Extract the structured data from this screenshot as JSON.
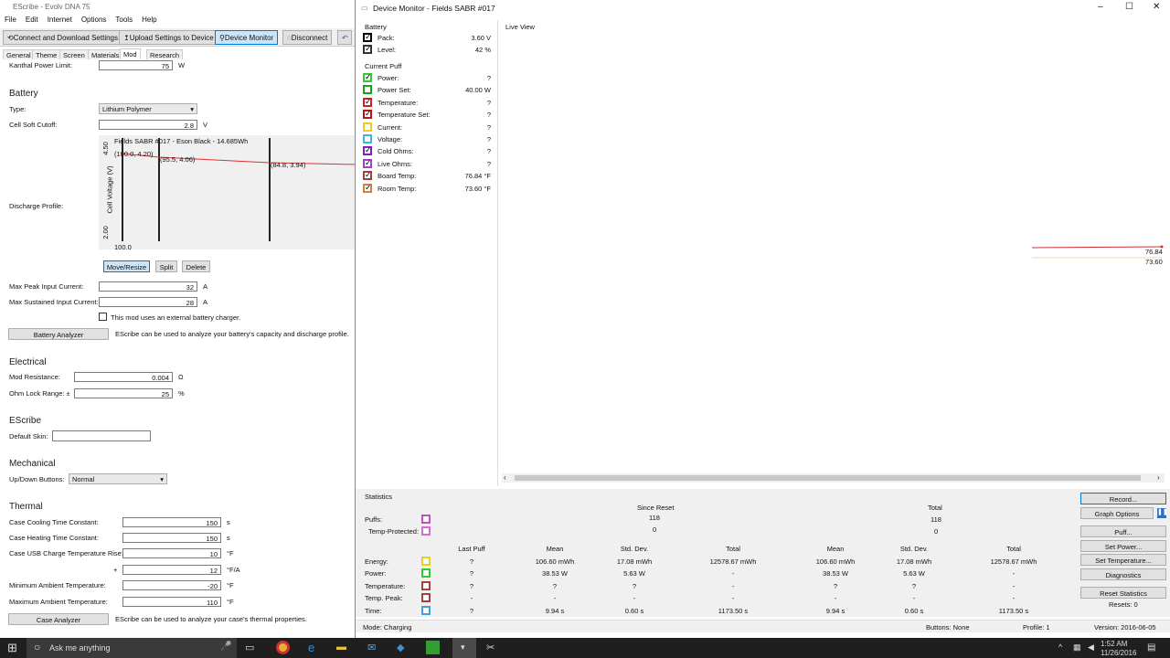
{
  "left_window": {
    "title": "EScribe - Evolv DNA 75",
    "menu": [
      "File",
      "Edit",
      "Internet",
      "Options",
      "Tools",
      "Help"
    ],
    "toolbar": {
      "connect": "Connect and Download Settings",
      "upload": "Upload Settings to Device",
      "monitor": "Device Monitor",
      "disconnect": "Disconnect"
    },
    "tabs": [
      "General",
      "Theme",
      "Screen",
      "Materials",
      "Mod",
      "Research"
    ],
    "kanthal_label": "Kanthal Power Limit:",
    "kanthal_value": "75",
    "kanthal_unit": "W",
    "battery": {
      "heading": "Battery",
      "type_label": "Type:",
      "type_value": "Lithium Polymer",
      "cutoff_label": "Cell Soft Cutoff:",
      "cutoff_value": "2.8",
      "cutoff_unit": "V",
      "discharge_label": "Discharge Profile:",
      "chart_title": "Fields SABR #017 - Eson Black - 14.685Wh",
      "ylabel": "Cell Voltage (V)",
      "ytop": "4.50",
      "ybot": "2.00",
      "xleft": "100.0",
      "pt1": "(100.0, 4.20)",
      "pt2": "(95.5, 4.06)",
      "pt3": "(84.8, 3.94)",
      "move": "Move/Resize",
      "split": "Split",
      "delete": "Delete",
      "peak_label": "Max Peak Input Current:",
      "peak_value": "32",
      "peak_unit": "A",
      "sust_label": "Max Sustained Input Current:",
      "sust_value": "28",
      "sust_unit": "A",
      "ext_label": "This mod uses an external battery charger.",
      "analyzer": "Battery Analyzer",
      "analyzer_note": "EScribe can be used to analyze your battery's capacity and discharge profile."
    },
    "electrical": {
      "heading": "Electrical",
      "res_label": "Mod Resistance:",
      "res_value": "0.004",
      "res_unit": "Ω",
      "ohm_label": "Ohm Lock Range: ±",
      "ohm_value": "25",
      "ohm_unit": "%"
    },
    "escribe": {
      "heading": "EScribe",
      "skin_label": "Default Skin:"
    },
    "mechanical": {
      "heading": "Mechanical",
      "ud_label": "Up/Down Buttons:",
      "ud_value": "Normal"
    },
    "thermal": {
      "heading": "Thermal",
      "rows": [
        {
          "label": "Case Cooling Time Constant:",
          "value": "150",
          "unit": "s"
        },
        {
          "label": "Case Heating Time Constant:",
          "value": "150",
          "unit": "s"
        },
        {
          "label": "Case USB Charge Temperature Rise:",
          "value": "10",
          "unit": "°F"
        },
        {
          "label": "",
          "value": "12",
          "unit": "°F/A"
        },
        {
          "label": "Minimum Ambient Temperature:",
          "value": "-20",
          "unit": "°F"
        },
        {
          "label": "Maximum Ambient Temperature:",
          "value": "110",
          "unit": "°F"
        }
      ],
      "analyzer": "Case Analyzer",
      "analyzer_note": "EScribe can be used to analyze your case's thermal properties."
    }
  },
  "monitor": {
    "title": "Device Monitor - Fields SABR #017",
    "battery_group": "Battery",
    "battery_rows": [
      {
        "label": "Pack:",
        "value": "3.60 V",
        "color": "#000000"
      },
      {
        "label": "Level:",
        "value": "42 %",
        "color": "#333333"
      }
    ],
    "puff_group": "Current Puff",
    "puff_rows": [
      {
        "label": "Power:",
        "value": "?",
        "color": "#2ecc2e",
        "checked": true
      },
      {
        "label": "Power Set:",
        "value": "40.00 W",
        "color": "#1aa01a",
        "checked": false
      },
      {
        "label": "Temperature:",
        "value": "?",
        "color": "#d42020",
        "checked": true
      },
      {
        "label": "Temperature Set:",
        "value": "?",
        "color": "#b01a1a",
        "checked": true
      },
      {
        "label": "Current:",
        "value": "?",
        "color": "#e8d020",
        "checked": false
      },
      {
        "label": "Voltage:",
        "value": "?",
        "color": "#40b8e0",
        "checked": false
      },
      {
        "label": "Cold Ohms:",
        "value": "?",
        "color": "#8020c0",
        "checked": true
      },
      {
        "label": "Live Ohms:",
        "value": "?",
        "color": "#a040d0",
        "checked": true
      },
      {
        "label": "Board Temp:",
        "value": "76.84 °F",
        "color": "#a04040",
        "checked": true
      },
      {
        "label": "Room Temp:",
        "value": "73.60 °F",
        "color": "#d08040",
        "checked": true
      }
    ],
    "live_view": "Live View",
    "v1": "76.84",
    "v2": "73.60",
    "stats": {
      "heading": "Statistics",
      "since": "Since Reset",
      "total": "Total",
      "puffs_label": "Puffs:",
      "puffs_since": "118",
      "puffs_total": "118",
      "tp_label": "Temp-Protected:",
      "tp_since": "0",
      "tp_total": "0",
      "cols": [
        "Last Puff",
        "Mean",
        "Std. Dev.",
        "Total",
        "Mean",
        "Std. Dev.",
        "Total"
      ],
      "rows": [
        {
          "label": "Energy:",
          "color": "#e8d020",
          "vals": [
            "?",
            "106.60 mWh",
            "17.08 mWh",
            "12578.67 mWh",
            "106.60 mWh",
            "17.08 mWh",
            "12578.67 mWh"
          ]
        },
        {
          "label": "Power:",
          "color": "#2ecc2e",
          "vals": [
            "?",
            "38.53 W",
            "5.63 W",
            "-",
            "38.53 W",
            "5.63 W",
            "-"
          ]
        },
        {
          "label": "Temperature:",
          "color": "#a04040",
          "vals": [
            "?",
            "?",
            "?",
            "-",
            "?",
            "?",
            "-"
          ]
        },
        {
          "label": "Temp. Peak:",
          "color": "#a04040",
          "vals": [
            "-",
            "-",
            "-",
            "-",
            "-",
            "-",
            "-"
          ]
        },
        {
          "label": "Time:",
          "color": "#40a0e0",
          "vals": [
            "?",
            "9.94 s",
            "0.60 s",
            "1173.50 s",
            "9.94 s",
            "0.60 s",
            "1173.50 s"
          ]
        }
      ]
    },
    "buttons": {
      "record": "Record...",
      "graph": "Graph Options",
      "puff": "Puff...",
      "power": "Set Power...",
      "temp": "Set Temperature...",
      "diag": "Diagnostics",
      "reset": "Reset Statistics",
      "resets": "Resets: 0"
    },
    "status": {
      "mode": "Mode: Charging",
      "buttons": "Buttons: None",
      "profile": "Profile: 1",
      "version": "Version: 2016-06-05"
    }
  },
  "taskbar": {
    "search": "Ask me anything",
    "time": "1:52 AM",
    "date": "11/26/2016"
  }
}
